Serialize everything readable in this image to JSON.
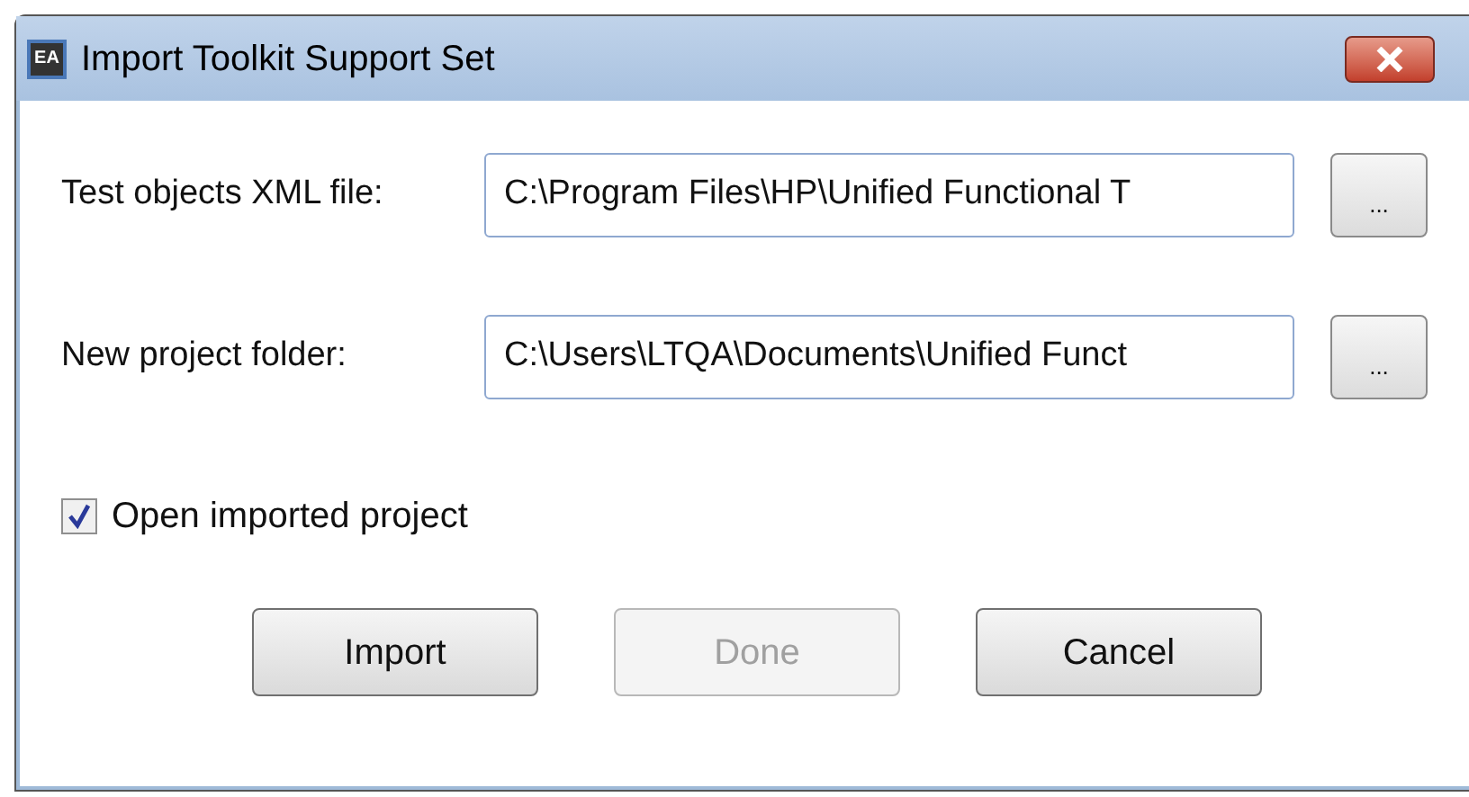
{
  "window": {
    "icon_text": "EA",
    "title": "Import Toolkit Support Set"
  },
  "fields": [
    {
      "label": "Test objects XML file:",
      "value": "C:\\Program Files\\HP\\Unified Functional T",
      "browse": "..."
    },
    {
      "label": "New project folder:",
      "value": "C:\\Users\\LTQA\\Documents\\Unified Funct",
      "browse": "..."
    }
  ],
  "checkbox": {
    "label": "Open imported project",
    "checked": true
  },
  "buttons": [
    {
      "label": "Import",
      "disabled": false
    },
    {
      "label": "Done",
      "disabled": true
    },
    {
      "label": "Cancel",
      "disabled": false
    }
  ]
}
